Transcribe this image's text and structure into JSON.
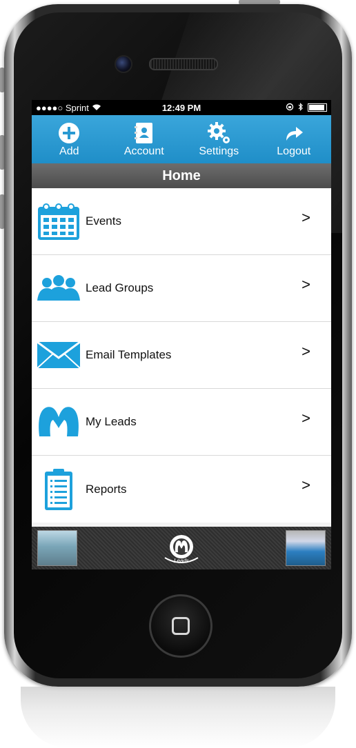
{
  "status_bar": {
    "carrier": "●●●●○ Sprint",
    "time": "12:49 PM"
  },
  "toolbar": {
    "items": [
      {
        "label": "Add",
        "icon": "plus-circle-icon"
      },
      {
        "label": "Account",
        "icon": "contact-book-icon"
      },
      {
        "label": "Settings",
        "icon": "gear-icon"
      },
      {
        "label": "Logout",
        "icon": "curved-arrow-icon"
      }
    ]
  },
  "header": {
    "title": "Home"
  },
  "menu": {
    "items": [
      {
        "label": "Events",
        "icon": "calendar-icon",
        "chevron": ">"
      },
      {
        "label": "Lead Groups",
        "icon": "people-group-icon",
        "chevron": ">"
      },
      {
        "label": "Email Templates",
        "icon": "envelope-icon",
        "chevron": ">"
      },
      {
        "label": "My Leads",
        "icon": "m-logo-icon",
        "chevron": ">"
      },
      {
        "label": "Reports",
        "icon": "clipboard-icon",
        "chevron": ">"
      }
    ]
  },
  "footer": {
    "logo_text": "Leads"
  },
  "colors": {
    "accent": "#2a9ad2",
    "header_bar": "#555555",
    "icon_blue": "#1da1dc"
  }
}
